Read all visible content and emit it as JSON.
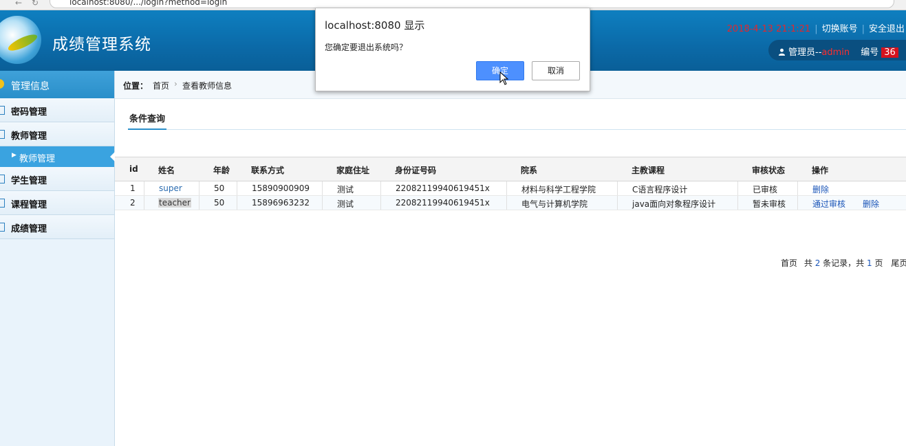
{
  "browser": {
    "url": "localhost:8080/.../login?method=login"
  },
  "header": {
    "title": "成绩管理系统",
    "datetime": "2018-4-13 21:1:21",
    "switch_account": "切换账号",
    "logout": "安全退出",
    "user_role": "管理员--",
    "user_name": "admin",
    "number_label": "编号",
    "number_value": "36"
  },
  "sidebar": {
    "head": "管理信息",
    "items": [
      {
        "label": "密码管理"
      },
      {
        "label": "教师管理"
      },
      {
        "label": "教师管理",
        "sub": true
      },
      {
        "label": "学生管理"
      },
      {
        "label": "课程管理"
      },
      {
        "label": "成绩管理"
      }
    ]
  },
  "breadcrumb": {
    "pos": "位置：",
    "home": "首页",
    "sep": "›",
    "current": "查看教师信息"
  },
  "tabs": {
    "active": "条件查询"
  },
  "table": {
    "headers": [
      "id",
      "姓名",
      "年龄",
      "联系方式",
      "家庭住址",
      "身份证号码",
      "院系",
      "主教课程",
      "审核状态",
      "操作"
    ],
    "rows": [
      {
        "id": "1",
        "name": "super",
        "age": "50",
        "phone": "15890900909",
        "addr": "测试",
        "idcard": "22082119940619451x",
        "dept": "材料与科学工程学院",
        "course": "C语言程序设计",
        "status": "已审核",
        "op1": "删除",
        "op2": ""
      },
      {
        "id": "2",
        "name": "teacher",
        "age": "50",
        "phone": "15896963232",
        "addr": "测试",
        "idcard": "22082119940619451x",
        "dept": "电气与计算机学院",
        "course": "java面向对象程序设计",
        "status": "暂未审核",
        "op1": "通过审核",
        "op2": "删除"
      }
    ]
  },
  "pager": {
    "first": "首页",
    "total_prefix": "共",
    "total": "2",
    "records": "条记录，共",
    "pages": "1",
    "page_unit": "页",
    "last": "尾页"
  },
  "dialog": {
    "title": "localhost:8080 显示",
    "message": "您确定要退出系统吗？",
    "ok": "确定",
    "cancel": "取消"
  },
  "colors": {
    "header_blue": "#0b6aa8",
    "accent": "#3aa3e0",
    "danger": "#d4121d",
    "link": "#1a55b8"
  }
}
